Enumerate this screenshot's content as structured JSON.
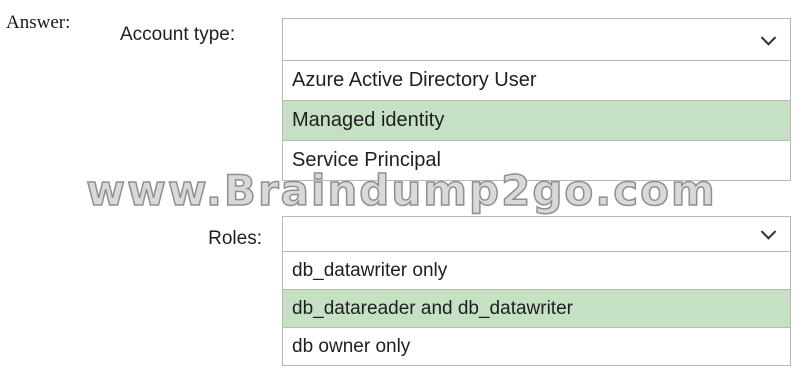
{
  "answer_label": "Answer:",
  "account_type": {
    "label": "Account type:",
    "selected_value": "",
    "options": [
      {
        "label": "Azure Active Directory User",
        "selected": false
      },
      {
        "label": "Managed identity",
        "selected": true
      },
      {
        "label": "Service Principal",
        "selected": false
      }
    ]
  },
  "roles": {
    "label": "Roles:",
    "selected_value": "",
    "options": [
      {
        "label": "db_datawriter only",
        "selected": false
      },
      {
        "label": "db_datareader and db_datawriter",
        "selected": true
      },
      {
        "label": "db owner only",
        "selected": false
      }
    ]
  },
  "watermark": "www.Braindump2go.com",
  "colors": {
    "selected_option_bg": "#c6e0c4",
    "border": "#b9b9b9"
  },
  "icons": {
    "dropdown": "chevron-down-icon"
  }
}
